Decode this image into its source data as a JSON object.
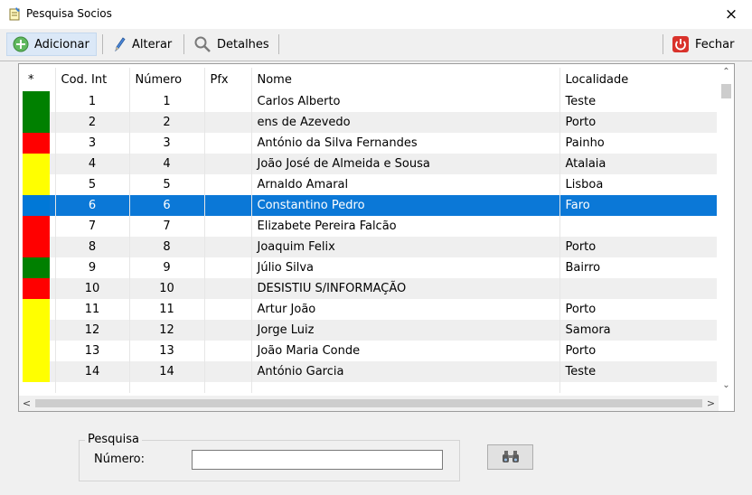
{
  "window": {
    "title": "Pesquisa Socios",
    "close_glyph": "×"
  },
  "toolbar": {
    "add_label": "Adicionar",
    "edit_label": "Alterar",
    "details_label": "Detalhes",
    "close_label": "Fechar"
  },
  "grid": {
    "columns": [
      "*",
      "Cod. Int",
      "Número",
      "Pfx",
      "Nome",
      "Localidade"
    ],
    "selected_row": 6,
    "colors": {
      "green": "#008000",
      "red": "#ff0000",
      "yellow": "#ffff00",
      "blue": "#0078d7",
      "selection": "#0078d7"
    },
    "rows": [
      {
        "marker": "green",
        "cod": "1",
        "numero": "1",
        "pfx": "",
        "nome": "Carlos Alberto",
        "localidade": "Teste"
      },
      {
        "marker": "green",
        "cod": "2",
        "numero": "2",
        "pfx": "",
        "nome": "ens de Azevedo",
        "localidade": "Porto"
      },
      {
        "marker": "red",
        "cod": "3",
        "numero": "3",
        "pfx": "",
        "nome": "António da Silva Fernandes",
        "localidade": "Painho"
      },
      {
        "marker": "yellow",
        "cod": "4",
        "numero": "4",
        "pfx": "",
        "nome": "João José de Almeida e Sousa",
        "localidade": "Atalaia"
      },
      {
        "marker": "yellow",
        "cod": "5",
        "numero": "5",
        "pfx": "",
        "nome": "Arnaldo Amaral",
        "localidade": "Lisboa"
      },
      {
        "marker": "blue",
        "cod": "6",
        "numero": "6",
        "pfx": "",
        "nome": "Constantino Pedro",
        "localidade": "Faro"
      },
      {
        "marker": "red",
        "cod": "7",
        "numero": "7",
        "pfx": "",
        "nome": "Elizabete Pereira Falcão",
        "localidade": ""
      },
      {
        "marker": "red",
        "cod": "8",
        "numero": "8",
        "pfx": "",
        "nome": "Joaquim Felix",
        "localidade": "Porto"
      },
      {
        "marker": "green",
        "cod": "9",
        "numero": "9",
        "pfx": "",
        "nome": "Júlio Silva",
        "localidade": "Bairro"
      },
      {
        "marker": "red",
        "cod": "10",
        "numero": "10",
        "pfx": "",
        "nome": "DESISTIU S/INFORMAÇÃO",
        "localidade": ""
      },
      {
        "marker": "yellow",
        "cod": "11",
        "numero": "11",
        "pfx": "",
        "nome": "Artur João",
        "localidade": "Porto"
      },
      {
        "marker": "yellow",
        "cod": "12",
        "numero": "12",
        "pfx": "",
        "nome": "Jorge Luiz",
        "localidade": "Samora"
      },
      {
        "marker": "yellow",
        "cod": "13",
        "numero": "13",
        "pfx": "",
        "nome": "João Maria Conde",
        "localidade": "Porto"
      },
      {
        "marker": "yellow",
        "cod": "14",
        "numero": "14",
        "pfx": "",
        "nome": "António  Garcia",
        "localidade": "Teste"
      }
    ]
  },
  "search": {
    "group_label": "Pesquisa",
    "field_label": "Número:",
    "value": ""
  },
  "icons": {
    "app": "notepad-icon",
    "add": "add-circle-icon",
    "edit": "pencil-icon",
    "details": "magnifier-icon",
    "close": "power-icon",
    "find": "binoculars-icon"
  }
}
